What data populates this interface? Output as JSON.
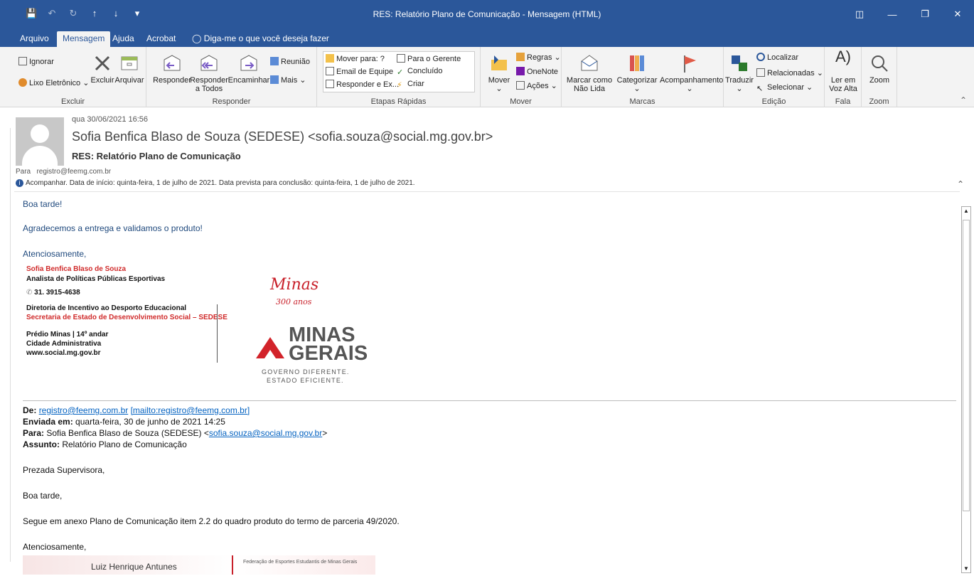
{
  "window": {
    "title": "RES: Relatório Plano de Comunicação - Mensagem (HTML)",
    "qat": [
      "save",
      "undo",
      "redo",
      "up",
      "down",
      "customize"
    ],
    "buttons": [
      "ribbon-display",
      "minimize",
      "restore",
      "close"
    ]
  },
  "tabs": [
    {
      "label": "Arquivo"
    },
    {
      "label": "Mensagem",
      "active": true
    },
    {
      "label": "Ajuda"
    },
    {
      "label": "Acrobat"
    },
    {
      "label": "Diga-me o que você deseja fazer"
    }
  ],
  "ribbon": {
    "excluir": {
      "label": "Excluir",
      "ignorar": "Ignorar",
      "lixo": "Lixo Eletrônico",
      "excluir_btn": "Excluir",
      "arquivar": "Arquivar"
    },
    "responder": {
      "label": "Responder",
      "responder": "Responder",
      "responder_todos_1": "Responder",
      "responder_todos_2": "a Todos",
      "encaminhar": "Encaminhar",
      "reuniao": "Reunião",
      "mais": "Mais"
    },
    "etapas": {
      "label": "Etapas Rápidas",
      "items": [
        "Mover para: ?",
        "Email de Equipe",
        "Responder e Ex...",
        "Para o Gerente",
        "Concluído",
        "Criar"
      ]
    },
    "mover": {
      "label": "Mover",
      "mover": "Mover",
      "regras": "Regras",
      "onenote": "OneNote",
      "acoes": "Ações"
    },
    "marcas": {
      "label": "Marcas",
      "marcar_1": "Marcar como",
      "marcar_2": "Não Lida",
      "categorizar": "Categorizar",
      "acompanhamento": "Acompanhamento"
    },
    "edicao": {
      "label": "Edição",
      "traduzir": "Traduzir",
      "localizar": "Localizar",
      "relacionadas": "Relacionadas",
      "selecionar": "Selecionar"
    },
    "fala": {
      "label": "Fala",
      "ler_1": "Ler em",
      "ler_2": "Voz Alta"
    },
    "zoom": {
      "label": "Zoom",
      "zoom": "Zoom"
    }
  },
  "message": {
    "date": "qua 30/06/2021 16:56",
    "sender": "Sofia Benfica Blaso de Souza (SEDESE) <sofia.souza@social.mg.gov.br>",
    "subject": "RES: Relatório Plano de Comunicação",
    "to_label": "Para",
    "to": "registro@feemg.com.br",
    "followup": "Acompanhar.  Data de início: quinta-feira, 1 de julho de 2021.  Data prevista para conclusão: quinta-feira, 1 de julho de 2021."
  },
  "body": {
    "greeting": "Boa tarde!",
    "line1": "Agradecemos a entrega e validamos o produto!",
    "closing": "Atenciosamente,",
    "signature": {
      "name": "Sofia Benfica Blaso de Souza",
      "role": "Analista de Políticas Públicas Esportivas",
      "phone": "31. 3915-4638",
      "dept": "Diretoria de Incentivo ao Desporto Educacional",
      "secretaria": "Secretaria de Estado de Desenvolvimento Social – SEDESE",
      "building": "Prédio Minas | 14º andar",
      "city": "Cidade Administrativa",
      "site": "www.social.mg.gov.br"
    },
    "logo": {
      "minas300_script": "Minas",
      "minas300_sub": "300 anos",
      "mg_1": "MINAS",
      "mg_2": "GERAIS",
      "tag_1": "GOVERNO DIFERENTE.",
      "tag_2": "ESTADO EFICIENTE."
    },
    "quoted": {
      "de_label": "De:",
      "de_email": "registro@feemg.com.br",
      "de_mailto": "[mailto:registro@feemg.com.br]",
      "enviada_label": "Enviada em:",
      "enviada": "quarta-feira, 30 de junho de 2021 14:25",
      "para_label": "Para:",
      "para_name": "Sofia Benfica Blaso de Souza (SEDESE) <",
      "para_email": "sofia.souza@social.mg.gov.br",
      "para_end": ">",
      "assunto_label": "Assunto:",
      "assunto": "Relatório Plano de Comunicação",
      "p1": "Prezada Supervisora,",
      "p2": "Boa tarde,",
      "p3": "Segue em anexo Plano de Comunicação item 2.2 do quadro produto do termo de parceria 49/2020.",
      "p4": "Atenciosamente,",
      "sig2_name": "Luiz Henrique Antunes",
      "sig2_org": "Federação de Esportes Estudantis de Minas Gerais"
    }
  }
}
